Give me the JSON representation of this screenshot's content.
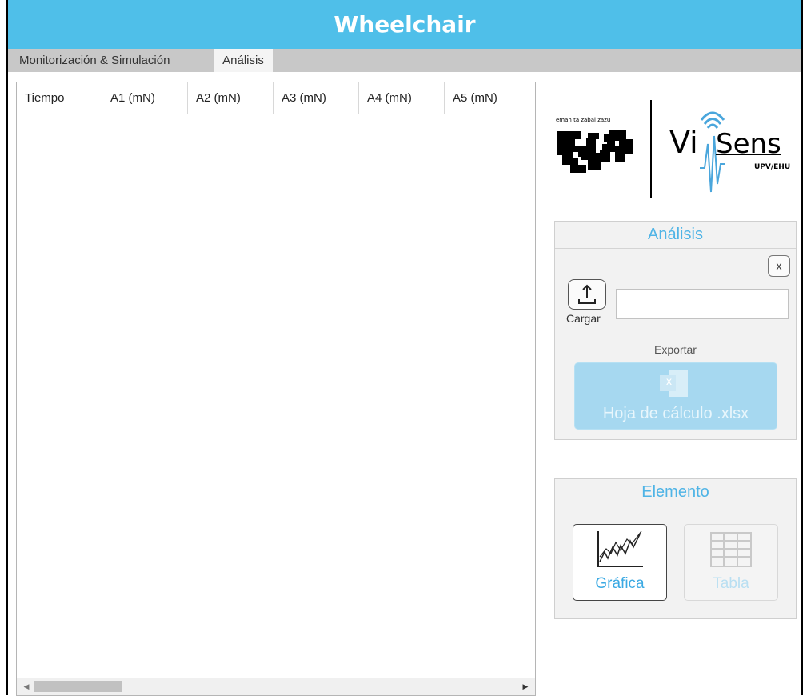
{
  "app": {
    "title": "Wheelchair"
  },
  "tabs": [
    {
      "label": "Monitorización & Simulación",
      "selected": false
    },
    {
      "label": "Análisis",
      "selected": true
    }
  ],
  "table": {
    "columns": [
      "Tiempo",
      "A1 (mN)",
      "A2 (mN)",
      "A3 (mN)",
      "A4 (mN)",
      "A5 (mN)"
    ],
    "rows": []
  },
  "logos": {
    "upv_motto": "eman ta zabal zazu",
    "visens_vi": "Vi",
    "visens_sens": "Sens",
    "visens_sub": "UPV/EHU"
  },
  "analisis_panel": {
    "title": "Análisis",
    "close_label": "x",
    "load_label": "Cargar",
    "file_value": "",
    "export_label": "Exportar",
    "xlsx_button_label": "Hoja de cálculo .xlsx",
    "xlsx_icon_letter": "x"
  },
  "elemento_panel": {
    "title": "Elemento",
    "grafica_label": "Gráfica",
    "tabla_label": "Tabla",
    "selected": "Gráfica"
  },
  "colors": {
    "accent": "#4fbfe9",
    "panel_title": "#4fb4e6",
    "disabled_button": "#a6d8f0"
  }
}
